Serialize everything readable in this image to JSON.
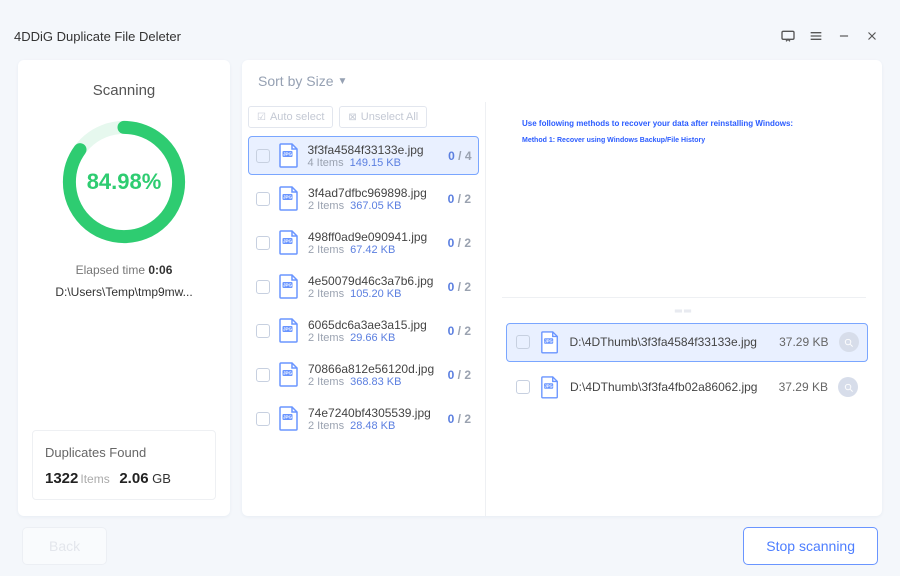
{
  "title": "4DDiG Duplicate File Deleter",
  "scan": {
    "heading": "Scanning",
    "percent": 84.98,
    "percent_label": "84.98%",
    "elapsed_label": "Elapsed time",
    "elapsed_value": "0:06",
    "path": "D:\\Users\\Temp\\tmp9mw...",
    "dup_found_label": "Duplicates Found",
    "dup_count": "1322",
    "dup_count_unit": "Items",
    "dup_size": "2.06",
    "dup_size_unit": "GB"
  },
  "sort_label": "Sort by Size",
  "tools": {
    "auto_select": "Auto select",
    "unselect_all": "Unselect All"
  },
  "groups": [
    {
      "name": "3f3fa4584f33133e.jpg",
      "items": 4,
      "size": "149.15 KB",
      "selected": 0,
      "total": 4,
      "highlighted": true
    },
    {
      "name": "3f4ad7dfbc969898.jpg",
      "items": 2,
      "size": "367.05 KB",
      "selected": 0,
      "total": 2
    },
    {
      "name": "498ff0ad9e090941.jpg",
      "items": 2,
      "size": "67.42 KB",
      "selected": 0,
      "total": 2
    },
    {
      "name": "4e50079d46c3a7b6.jpg",
      "items": 2,
      "size": "105.20 KB",
      "selected": 0,
      "total": 2
    },
    {
      "name": "6065dc6a3ae3a15.jpg",
      "items": 2,
      "size": "29.66 KB",
      "selected": 0,
      "total": 2
    },
    {
      "name": "70866a812e56120d.jpg",
      "items": 2,
      "size": "368.83 KB",
      "selected": 0,
      "total": 2
    },
    {
      "name": "74e7240bf4305539.jpg",
      "items": 2,
      "size": "28.48 KB",
      "selected": 0,
      "total": 2
    }
  ],
  "preview": {
    "line1": "Use following methods to recover your data after reinstalling Windows:",
    "line2": "Method 1: Recover using Windows Backup/File History"
  },
  "duplicates": [
    {
      "path": "D:\\4DThumb\\3f3fa4584f33133e.jpg",
      "size": "37.29 KB",
      "selected": true
    },
    {
      "path": "D:\\4DThumb\\3f3fa4fb02a86062.jpg",
      "size": "37.29 KB",
      "selected": false
    }
  ],
  "footer": {
    "back": "Back",
    "stop": "Stop scanning"
  },
  "items_word": "Items"
}
